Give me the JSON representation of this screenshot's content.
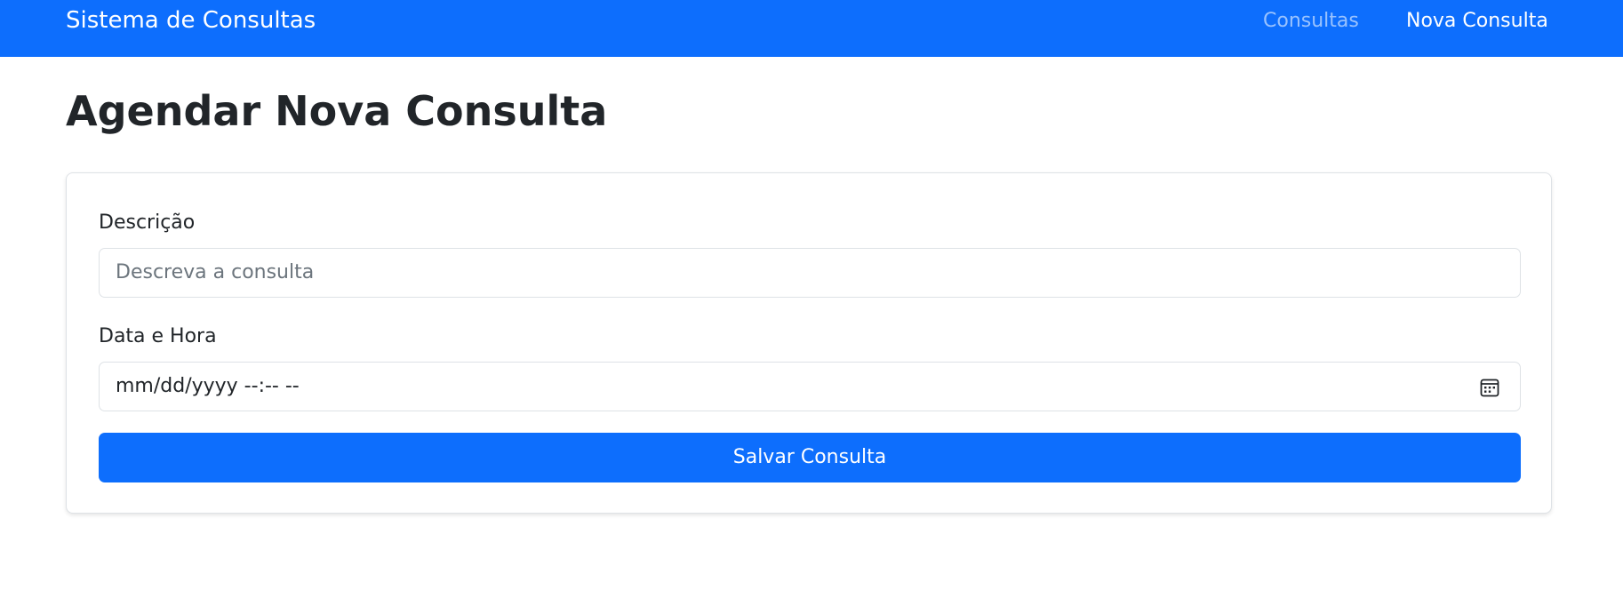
{
  "navbar": {
    "brand": "Sistema de Consultas",
    "links": [
      {
        "label": "Consultas"
      },
      {
        "label": "Nova Consulta"
      }
    ]
  },
  "page": {
    "title": "Agendar Nova Consulta"
  },
  "form": {
    "description": {
      "label": "Descrição",
      "placeholder": "Descreva a consulta",
      "value": ""
    },
    "datetime": {
      "label": "Data e Hora",
      "display": "mm/dd/yyyy --:-- --",
      "icon": "calendar-icon"
    },
    "submit_label": "Salvar Consulta"
  },
  "colors": {
    "primary": "#0d6efd",
    "text": "#212529",
    "border": "#dee2e6",
    "placeholder": "#6c757d"
  }
}
